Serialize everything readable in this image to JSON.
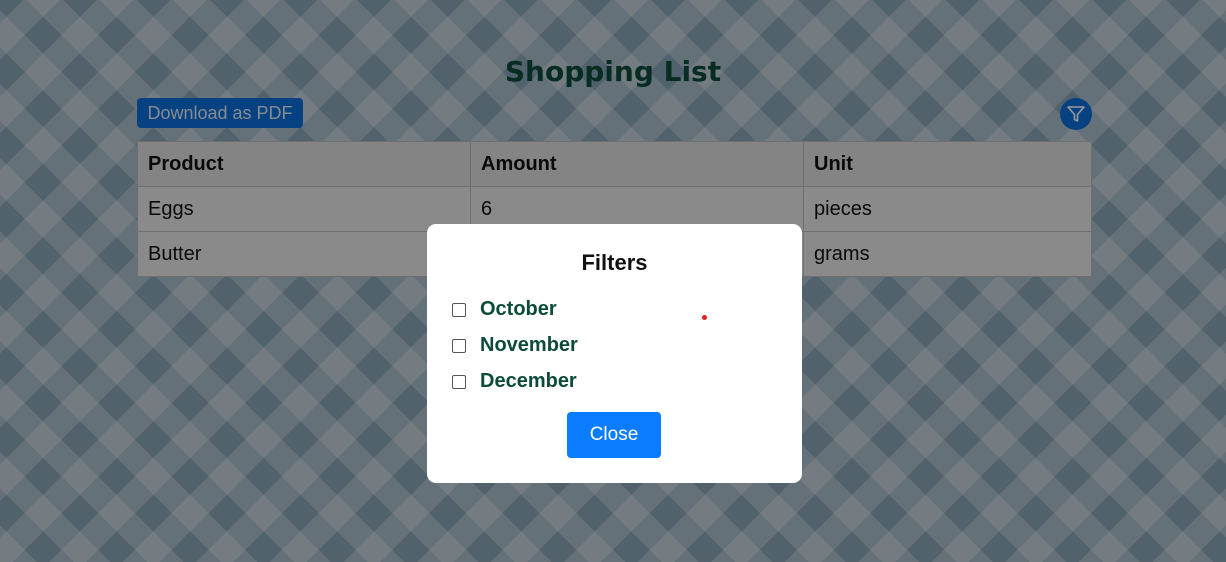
{
  "page": {
    "title": "Shopping List",
    "download_label": "Download as PDF",
    "filter_icon": "funnel-icon"
  },
  "table": {
    "headers": [
      "Product",
      "Amount",
      "Unit"
    ],
    "rows": [
      [
        "Eggs",
        "6",
        "pieces"
      ],
      [
        "Butter",
        "",
        "grams"
      ]
    ]
  },
  "modal": {
    "title": "Filters",
    "options": [
      {
        "label": "October",
        "checked": false
      },
      {
        "label": "November",
        "checked": false
      },
      {
        "label": "December",
        "checked": false
      }
    ],
    "close_label": "Close"
  },
  "colors": {
    "title_green": "#0c4a3a",
    "primary_blue": "#0a7cff",
    "cursor_red": "#e0201e"
  }
}
